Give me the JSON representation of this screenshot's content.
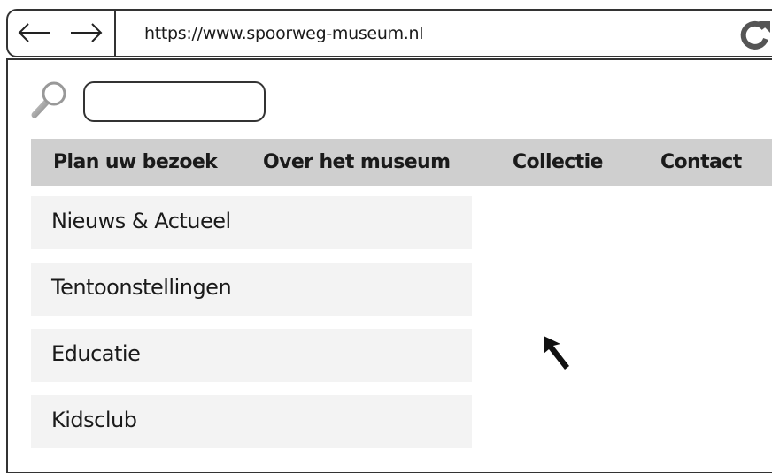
{
  "browser": {
    "url": "https://www.spoorweg-museum.nl",
    "icons": {
      "back": "arrow-left-icon",
      "forward": "arrow-right-icon",
      "reload": "reload-icon"
    }
  },
  "search": {
    "icon": "magnifier-icon",
    "value": "",
    "placeholder": ""
  },
  "navbar": {
    "items": [
      {
        "label": "Plan uw bezoek"
      },
      {
        "label": "Over het museum"
      },
      {
        "label": "Collectie"
      },
      {
        "label": "Contact"
      }
    ]
  },
  "submenu": {
    "items": [
      {
        "label": "Nieuws & Actueel"
      },
      {
        "label": "Tentoonstellingen"
      },
      {
        "label": "Educatie"
      },
      {
        "label": "Kidsclub"
      }
    ]
  },
  "colors": {
    "navbar_bg": "#cfcfcf",
    "submenu_bg": "#f3f3f3",
    "outline": "#333333"
  }
}
